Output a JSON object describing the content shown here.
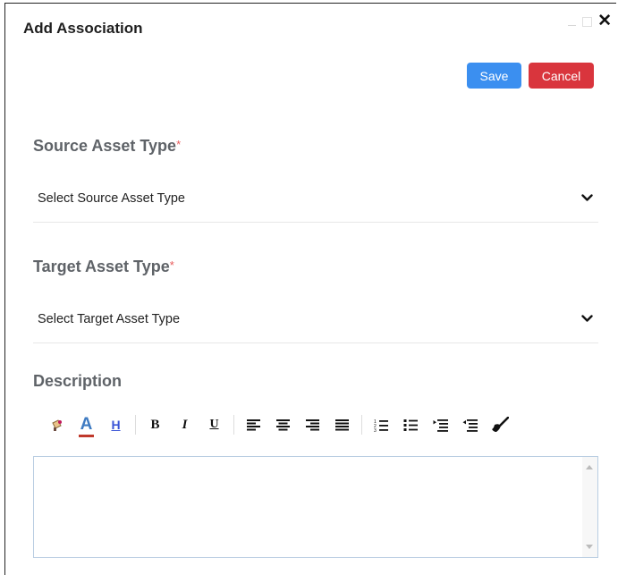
{
  "dialog": {
    "title": "Add Association",
    "close_glyph": "✕"
  },
  "actions": {
    "save_label": "Save",
    "cancel_label": "Cancel",
    "save_color": "#3b8ff0",
    "cancel_color": "#d9353d"
  },
  "fields": {
    "source": {
      "label": "Source Asset Type",
      "required_mark": "*",
      "selected": "Select Source Asset Type"
    },
    "target": {
      "label": "Target Asset Type",
      "required_mark": "*",
      "selected": "Select Target Asset Type"
    },
    "description": {
      "label": "Description",
      "value": ""
    }
  },
  "toolbar": {
    "font_color_glyph": "A",
    "highlight_glyph": "H",
    "bold_glyph": "B",
    "italic_glyph": "I",
    "underline_glyph": "U",
    "icons": [
      "paint-icon",
      "font-color-icon",
      "highlight-icon",
      "bold-icon",
      "italic-icon",
      "underline-icon",
      "align-left-icon",
      "align-center-icon",
      "align-right-icon",
      "justify-icon",
      "ordered-list-icon",
      "unordered-list-icon",
      "indent-icon",
      "outdent-icon",
      "clear-format-icon"
    ]
  }
}
